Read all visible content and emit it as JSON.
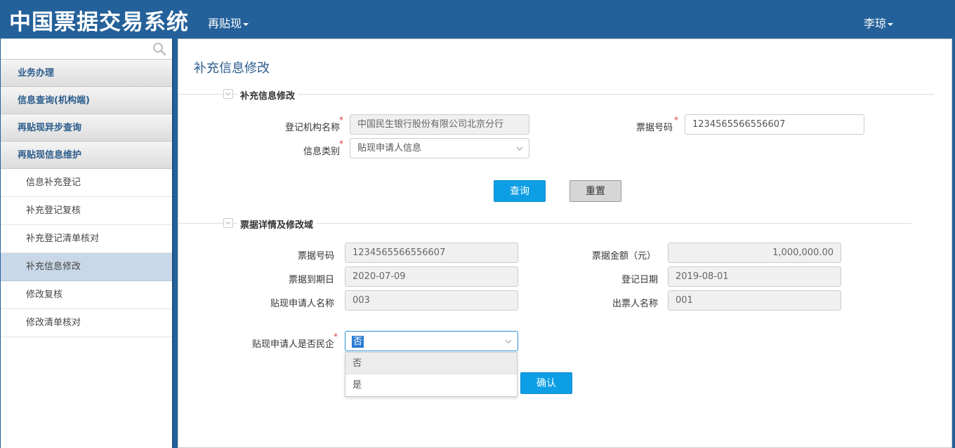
{
  "header": {
    "app_title": "中国票据交易系统",
    "menu_label": "再贴现",
    "user_name": "李琼"
  },
  "sidebar": {
    "search_placeholder": "",
    "groups": [
      {
        "label": "业务办理"
      },
      {
        "label": "信息查询(机构端)"
      },
      {
        "label": "再贴现异步查询"
      },
      {
        "label": "再贴现信息维护"
      }
    ],
    "items": [
      {
        "label": "信息补充登记"
      },
      {
        "label": "补充登记复核"
      },
      {
        "label": "补充登记清单核对"
      },
      {
        "label": "补充信息修改"
      },
      {
        "label": "修改复核"
      },
      {
        "label": "修改清单核对"
      }
    ],
    "active_item": "补充信息修改"
  },
  "main": {
    "page_title": "补充信息修改",
    "query_section": {
      "title": "补充信息修改",
      "org_label": "登记机构名称",
      "org_value": "中国民生银行股份有限公司北京分行",
      "bill_no_label": "票据号码",
      "bill_no_value": "1234565566556607",
      "info_type_label": "信息类别",
      "info_type_value": "贴现申请人信息",
      "query_button": "查询",
      "reset_button": "重置"
    },
    "detail_section": {
      "title": "票据详情及修改域",
      "bill_no_label": "票据号码",
      "bill_no_value": "1234565566556607",
      "amount_label": "票据金额（元）",
      "amount_value": "1,000,000.00",
      "due_date_label": "票据到期日",
      "due_date_value": "2020-07-09",
      "reg_date_label": "登记日期",
      "reg_date_value": "2019-08-01",
      "applicant_label": "贴现申请人名称",
      "applicant_value": "003",
      "drawer_label": "出票人名称",
      "drawer_value": "001",
      "private_label": "贴现申请人是否民企",
      "private_value": "否",
      "private_options": [
        "否",
        "是"
      ],
      "confirm_button": "确认"
    }
  },
  "colors": {
    "header_bg": "#24619a",
    "primary_button": "#0d9ee5",
    "required_star": "#e4393c"
  }
}
